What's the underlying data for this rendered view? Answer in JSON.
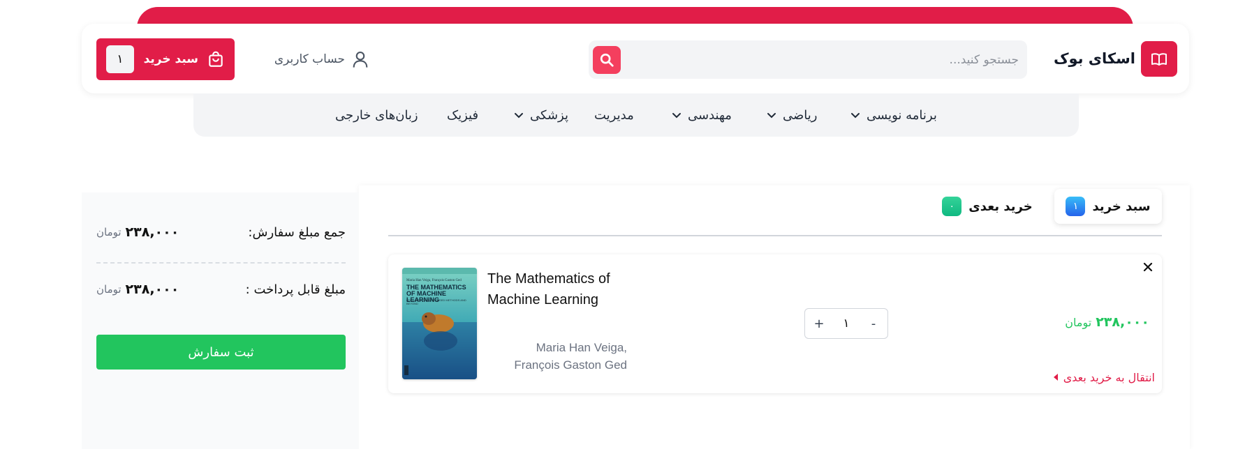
{
  "brand": {
    "name": "اسکای بوک"
  },
  "search": {
    "placeholder": "جستجو کنید..."
  },
  "account": {
    "label": "حساب کاربری"
  },
  "cart_button": {
    "label": "سبد خرید",
    "count": "۱"
  },
  "nav": [
    {
      "label": "برنامه نویسی",
      "has_dropdown": true
    },
    {
      "label": "ریاضی",
      "has_dropdown": true
    },
    {
      "label": "مهندسی",
      "has_dropdown": true
    },
    {
      "label": "مدیریت",
      "has_dropdown": false
    },
    {
      "label": "پزشکی",
      "has_dropdown": true
    },
    {
      "label": "فیزیک",
      "has_dropdown": false
    },
    {
      "label": "زبان‌های خارجی",
      "has_dropdown": false
    }
  ],
  "tabs": [
    {
      "label": "سبد خرید",
      "count": "۱",
      "active": true
    },
    {
      "label": "خرید بعدی",
      "count": "۰",
      "active": false
    }
  ],
  "cart_item": {
    "title": "The Mathematics of Machine Learning",
    "authors": "Maria Han Veiga, François Gaston Ged",
    "quantity": "۱",
    "price": "۲۳۸,۰۰۰",
    "currency": "تومان",
    "move_label": "انتقال به خرید بعدی",
    "cover_title": "THE MATHEMATICS OF MACHINE LEARNING",
    "cover_subtitle": "LECTURES ON SUPERVISED METHODS AND BEYOND",
    "cover_authors": "Maria Han Veiga, François Gaston Ged"
  },
  "summary": {
    "total_label": "جمع مبلغ سفارش:",
    "total_value": "۲۳۸,۰۰۰",
    "payable_label": "مبلغ قابل پرداخت :",
    "payable_value": "۲۳۸,۰۰۰",
    "currency": "تومان",
    "submit_label": "ثبت سفارش"
  },
  "colors": {
    "brand": "#e11d48",
    "success": "#22c55e",
    "search_button": "#f43f5e"
  }
}
